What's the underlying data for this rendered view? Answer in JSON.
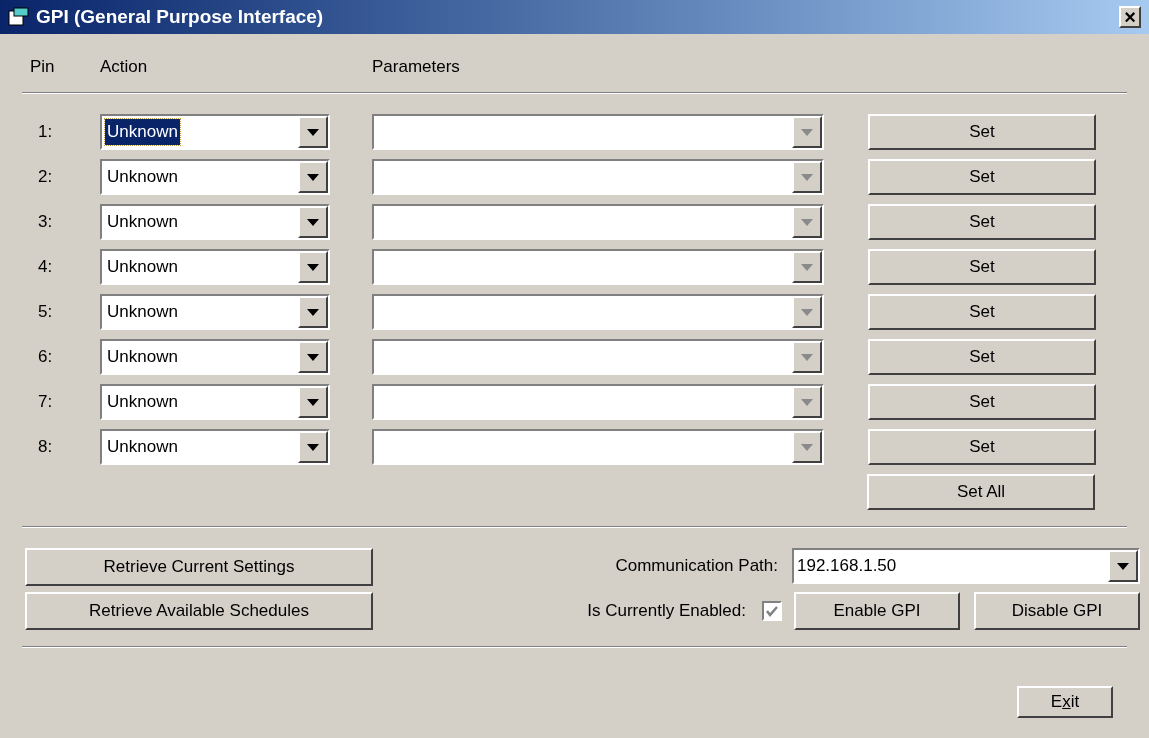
{
  "window": {
    "title": "GPI (General Purpose Interface)",
    "close": "×"
  },
  "headers": {
    "pin": "Pin",
    "action": "Action",
    "parameters": "Parameters"
  },
  "pins": [
    {
      "label": "1:",
      "action": "Unknown",
      "focused": true,
      "parameters_disabled": true,
      "set": "Set"
    },
    {
      "label": "2:",
      "action": "Unknown",
      "focused": false,
      "parameters_disabled": true,
      "set": "Set"
    },
    {
      "label": "3:",
      "action": "Unknown",
      "focused": false,
      "parameters_disabled": true,
      "set": "Set"
    },
    {
      "label": "4:",
      "action": "Unknown",
      "focused": false,
      "parameters_disabled": true,
      "set": "Set"
    },
    {
      "label": "5:",
      "action": "Unknown",
      "focused": false,
      "parameters_disabled": true,
      "set": "Set"
    },
    {
      "label": "6:",
      "action": "Unknown",
      "focused": false,
      "parameters_disabled": true,
      "set": "Set"
    },
    {
      "label": "7:",
      "action": "Unknown",
      "focused": false,
      "parameters_disabled": true,
      "set": "Set"
    },
    {
      "label": "8:",
      "action": "Unknown",
      "focused": false,
      "parameters_disabled": true,
      "set": "Set"
    }
  ],
  "set_all": "Set All",
  "retrieve_buttons": [
    "Retrieve Current Settings",
    "Retrieve Available Schedules"
  ],
  "communication_path": {
    "label": "Communication Path:",
    "value": "192.168.1.50"
  },
  "enabled": {
    "label": "Is Currently Enabled:",
    "checked": true,
    "disabled": true
  },
  "gpi_buttons": [
    "Enable GPI",
    "Disable GPI"
  ],
  "exit": {
    "before": "E",
    "mnemonic": "x",
    "after": "it"
  }
}
